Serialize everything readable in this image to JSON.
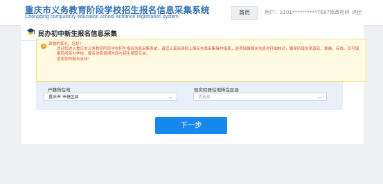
{
  "header": {
    "title": "重庆市义务教育阶段学校招生报名信息采集系统",
    "subtitle": "Chongqing compulsory education school entrance registration system",
    "nav_home": "首页",
    "user_label": "用户：1101**********7687",
    "change_password": "修改密码",
    "logout": "退出"
  },
  "page": {
    "icon": "graduation-cap-icon",
    "title": "民办初中新生报名信息采集"
  },
  "notice": {
    "icon": "info-icon",
    "greeting": "尊敬的家长，您好！",
    "body": "欢迎您进入重庆市义务教育阶段学校招生报名信息采集系统，请您认真阅读网上报名信息采集操作指南，逐项填报相关信息并仔细核对，确保所填信息真实、准确、有效。仅可填报同所民办学校，报名信息填报时间与招生录取无关。",
    "thanks": "感谢您的配合支持！"
  },
  "form": {
    "household_label": "户籍所在地",
    "household_value": "重庆市 市辖区县",
    "residence_label": "现实际居住地所在区县",
    "residence_placeholder": "请选择"
  },
  "actions": {
    "next_label": "下一步"
  },
  "colors": {
    "brand": "#2f6fb6",
    "notice_text": "#e04a3c",
    "notice_bg": "#fffbe1",
    "primary_button": "#1688ee"
  }
}
